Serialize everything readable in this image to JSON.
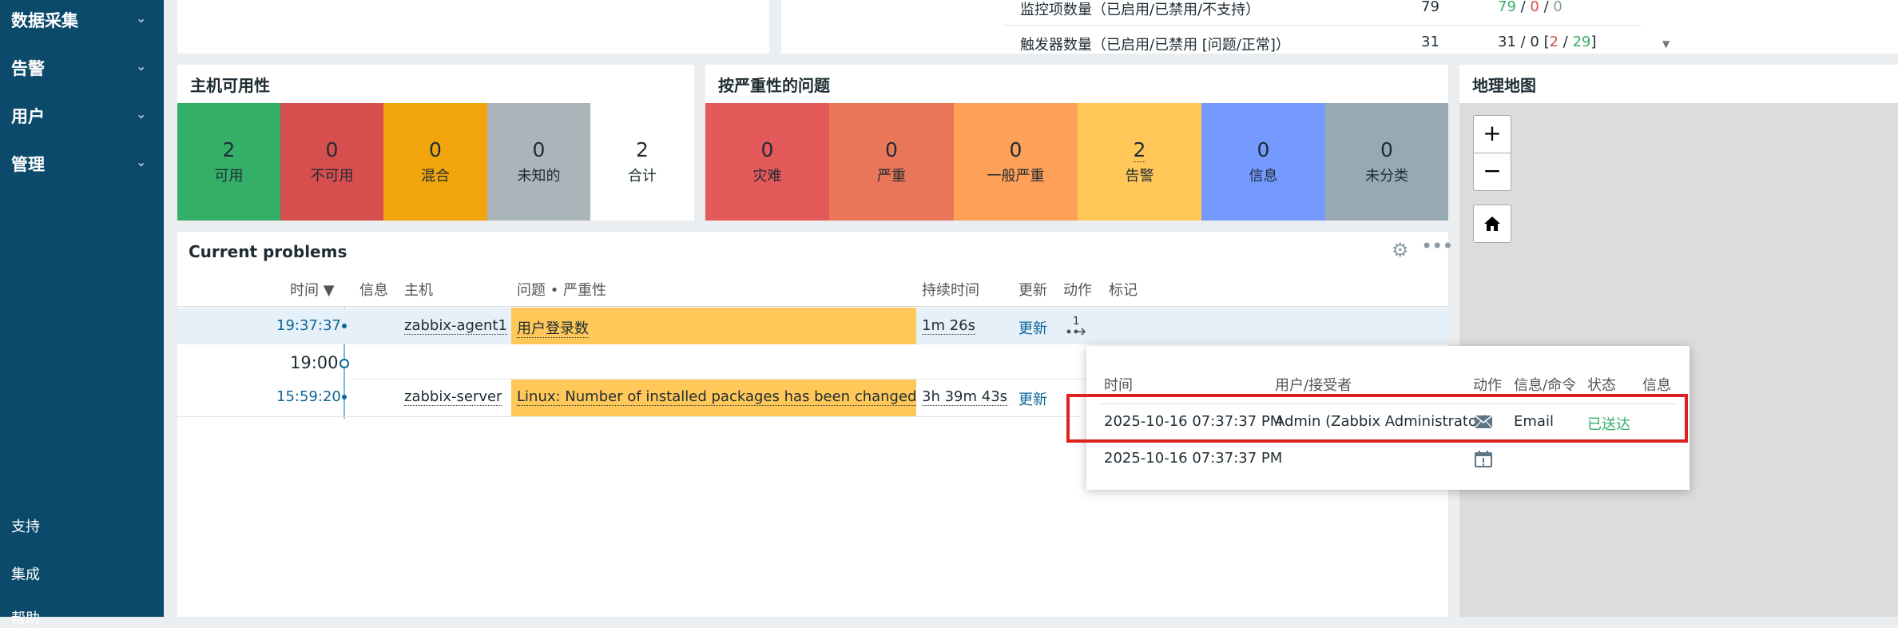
{
  "sidebar": {
    "items": [
      {
        "label": "数据采集"
      },
      {
        "label": "告警"
      },
      {
        "label": "用户"
      },
      {
        "label": "管理"
      }
    ],
    "bottom": [
      {
        "label": "支持"
      },
      {
        "label": "集成"
      },
      {
        "label": "帮助"
      }
    ]
  },
  "top_stats": {
    "rows": [
      {
        "label": "监控项数量（已启用/已禁用/不支持）",
        "total": "79",
        "v1": "79",
        "sep1": " / ",
        "v2": "0",
        "sep2": " / ",
        "v3": "0",
        "open": "",
        "close": ""
      },
      {
        "label": "触发器数量（已启用/已禁用 [问题/正常]）",
        "total": "31",
        "v1": "31 / 0 [",
        "sep1": "",
        "v2": "2",
        "sep2": " / ",
        "v3": "29",
        "open": "",
        "close": "]"
      }
    ]
  },
  "host_availability": {
    "title": "主机可用性",
    "cells": [
      {
        "num": "2",
        "label": "可用"
      },
      {
        "num": "0",
        "label": "不可用"
      },
      {
        "num": "0",
        "label": "混合"
      },
      {
        "num": "0",
        "label": "未知的"
      },
      {
        "num": "2",
        "label": "合计"
      }
    ]
  },
  "severity": {
    "title": "按严重性的问题",
    "cells": [
      {
        "num": "0",
        "label": "灾难"
      },
      {
        "num": "0",
        "label": "严重"
      },
      {
        "num": "0",
        "label": "一般严重"
      },
      {
        "num": "2",
        "label": "告警"
      },
      {
        "num": "0",
        "label": "信息"
      },
      {
        "num": "0",
        "label": "未分类"
      }
    ]
  },
  "map": {
    "title": "地理地图",
    "zoom_in": "+",
    "zoom_out": "−",
    "home_icon": "home-icon"
  },
  "problems": {
    "title": "Current problems",
    "headers": {
      "time": "时间 ▼",
      "info": "信息",
      "host": "主机",
      "problem": "问题 • 严重性",
      "duration": "持续时间",
      "update": "更新",
      "actions": "动作",
      "tags": "标记"
    },
    "rows": [
      {
        "time": "19:37:37",
        "host": "zabbix-agent1",
        "problem": "用户登录数",
        "duration": "1m 26s",
        "update": "更新",
        "actions_count": "1"
      },
      {
        "time": "15:59:20",
        "host": "zabbix-server",
        "problem": "Linux: Number of installed packages has been changed",
        "duration": "3h 39m 43s",
        "update": "更新"
      }
    ],
    "time_marker": "19:00"
  },
  "popup": {
    "headers": {
      "time": "时间",
      "user": "用户/接受者",
      "action": "动作",
      "message": "信息/命令",
      "status": "状态",
      "info": "信息"
    },
    "rows": [
      {
        "time": "2025-10-16 07:37:37 PM",
        "user": "Admin (Zabbix Administrator)",
        "message": "Email",
        "status": "已送达"
      },
      {
        "time": "2025-10-16 07:37:37 PM",
        "user": "",
        "message": "",
        "status": ""
      }
    ]
  },
  "colors": {
    "available": "#34af67",
    "unavailable": "#d64e4e",
    "mixed": "#f2a50d",
    "unknown": "#aab5ba",
    "disaster": "#e45959",
    "high": "#e97659",
    "average": "#ffa059",
    "warning": "#ffc859",
    "information": "#7499ff",
    "not_classified": "#97aab3",
    "highlight_border": "#e02020"
  }
}
